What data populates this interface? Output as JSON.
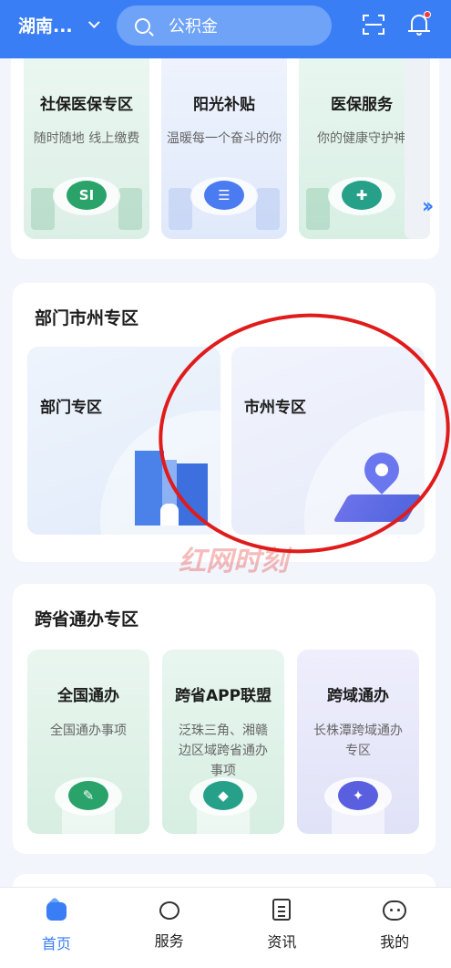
{
  "header": {
    "city": "湖南...",
    "search_placeholder": "公积金",
    "accent": "#3a7ef6"
  },
  "top_services": [
    {
      "title": "社保医保专区",
      "desc": "随时随地 线上缴费",
      "icon": "social-security-icon"
    },
    {
      "title": "阳光补贴",
      "desc": "温暖每一个奋斗的你",
      "icon": "id-card-icon"
    },
    {
      "title": "医保服务",
      "desc": "你的健康守护神",
      "icon": "medical-shield-icon"
    }
  ],
  "dept_section": {
    "title": "部门市州专区",
    "cards": [
      {
        "title": "部门专区",
        "icon": "building-icon"
      },
      {
        "title": "市州专区",
        "icon": "map-pin-icon"
      }
    ]
  },
  "cross_section": {
    "title": "跨省通办专区",
    "cards": [
      {
        "title": "全国通办",
        "desc": "全国通办事项",
        "icon": "checklist-icon"
      },
      {
        "title": "跨省APP联盟",
        "desc": "泛珠三角、湘赣边区域跨省通办事项",
        "icon": "location-icon"
      },
      {
        "title": "跨域通办",
        "desc": "长株潭跨域通办专区",
        "icon": "region-map-icon"
      }
    ]
  },
  "watermark": "红网时刻",
  "tabs": [
    {
      "label": "首页",
      "icon": "home-icon",
      "active": true
    },
    {
      "label": "服务",
      "icon": "service-heart-icon",
      "active": false
    },
    {
      "label": "资讯",
      "icon": "news-icon",
      "active": false
    },
    {
      "label": "我的",
      "icon": "profile-icon",
      "active": false
    }
  ]
}
